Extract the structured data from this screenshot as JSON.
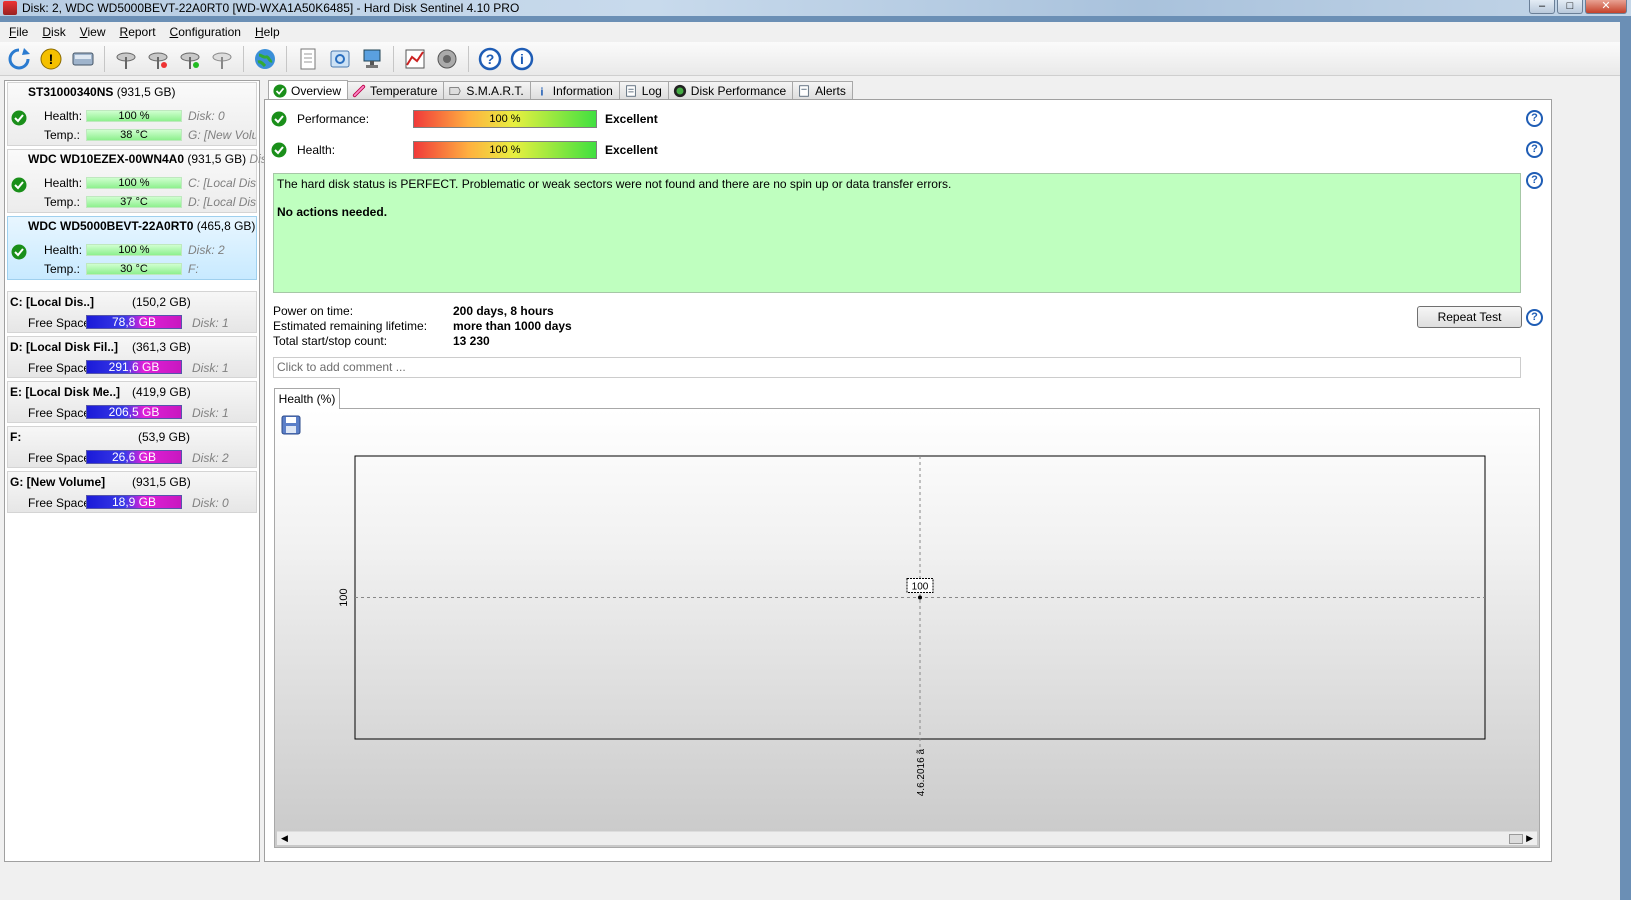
{
  "window": {
    "title": "Disk: 2, WDC WD5000BEVT-22A0RT0 [WD-WXA1A50K6485]  -  Hard Disk Sentinel 4.10 PRO"
  },
  "menu": [
    "File",
    "Disk",
    "View",
    "Report",
    "Configuration",
    "Help"
  ],
  "toolbar": {
    "icons": [
      "refresh-icon",
      "warning-icon",
      "disk-icon",
      "satellite-icon",
      "satellite-icon",
      "satellite-green-icon",
      "satellite-gray-icon",
      "globe-icon",
      "report-icon",
      "sync-icon",
      "network-icon",
      "graph-icon",
      "speaker-icon",
      "help-icon",
      "info-icon"
    ]
  },
  "disks": [
    {
      "name": "ST31000340NS",
      "size": "(931,5 GB)",
      "health_label": "Health:",
      "health": "100 %",
      "health_fraction": 1.0,
      "temp_label": "Temp.:",
      "temp": "38 °C",
      "side1": "Disk: 0",
      "side2": "G: [New Volu"
    },
    {
      "name": "WDC WD10EZEX-00WN4A0",
      "size": "(931,5 GB)",
      "size_extra": "Disk",
      "health_label": "Health:",
      "health": "100 %",
      "health_fraction": 1.0,
      "temp_label": "Temp.:",
      "temp": "37 °C",
      "side1": "C: [Local Disk",
      "side2": "D: [Local Disk"
    },
    {
      "name": "WDC WD5000BEVT-22A0RT0",
      "size": "(465,8 GB)",
      "health_label": "Health:",
      "health": "100 %",
      "health_fraction": 1.0,
      "temp_label": "Temp.:",
      "temp": "30 °C",
      "side1": "Disk: 2",
      "side2": "F:"
    }
  ],
  "volumes": [
    {
      "name": "C: [Local Dis..]",
      "size": "(150,2 GB)",
      "fs_label": "Free Space",
      "free": "78,8 GB",
      "disk": "Disk: 1"
    },
    {
      "name": "D: [Local Disk Fil..]",
      "size": "(361,3 GB)",
      "fs_label": "Free Space",
      "free": "291,6 GB",
      "disk": "Disk: 1"
    },
    {
      "name": "E: [Local Disk Me..]",
      "size": "(419,9 GB)",
      "fs_label": "Free Space",
      "free": "206,5 GB",
      "disk": "Disk: 1"
    },
    {
      "name": "F:",
      "size": "(53,9 GB)",
      "fs_label": "Free Space",
      "free": "26,6 GB",
      "disk": "Disk: 2"
    },
    {
      "name": "G: [New Volume]",
      "size": "(931,5 GB)",
      "fs_label": "Free Space",
      "free": "18,9 GB",
      "disk": "Disk: 0"
    }
  ],
  "tabs": [
    "Overview",
    "Temperature",
    "S.M.A.R.T.",
    "Information",
    "Log",
    "Disk Performance",
    "Alerts"
  ],
  "overview": {
    "performance_label": "Performance:",
    "performance_value": "100 %",
    "performance_status": "Excellent",
    "health_label": "Health:",
    "health_value": "100 %",
    "health_status": "Excellent",
    "status_text": "The hard disk status is PERFECT. Problematic or weak sectors were not found and there are no spin up or data transfer errors.",
    "status_action": "No actions needed.",
    "power_on_label": "Power on time:",
    "power_on_value": "200 days, 8 hours",
    "lifetime_label": "Estimated remaining lifetime:",
    "lifetime_value": "more than 1000 days",
    "startstop_label": "Total start/stop count:",
    "startstop_value": "13 230",
    "repeat_button": "Repeat Test",
    "comment_placeholder": "Click to add comment ...",
    "subtab": "Health (%)",
    "help_glyph": "?"
  },
  "chart_data": {
    "type": "line",
    "title": "Health (%)",
    "x": [
      "4.6.2016 ã"
    ],
    "series": [
      {
        "values": [
          100
        ]
      }
    ],
    "ytick_labels": [
      "100"
    ],
    "point_labels": [
      "100"
    ],
    "grid": true
  },
  "colors": {
    "status_bg": "#bfffbf",
    "selected_disk": "#c8eaff",
    "health_bar": "#8ef08e",
    "free_space_bar_start": "#1a1ad8",
    "free_space_bar_end": "#e020d8",
    "help_blue": "#1f5db5"
  }
}
